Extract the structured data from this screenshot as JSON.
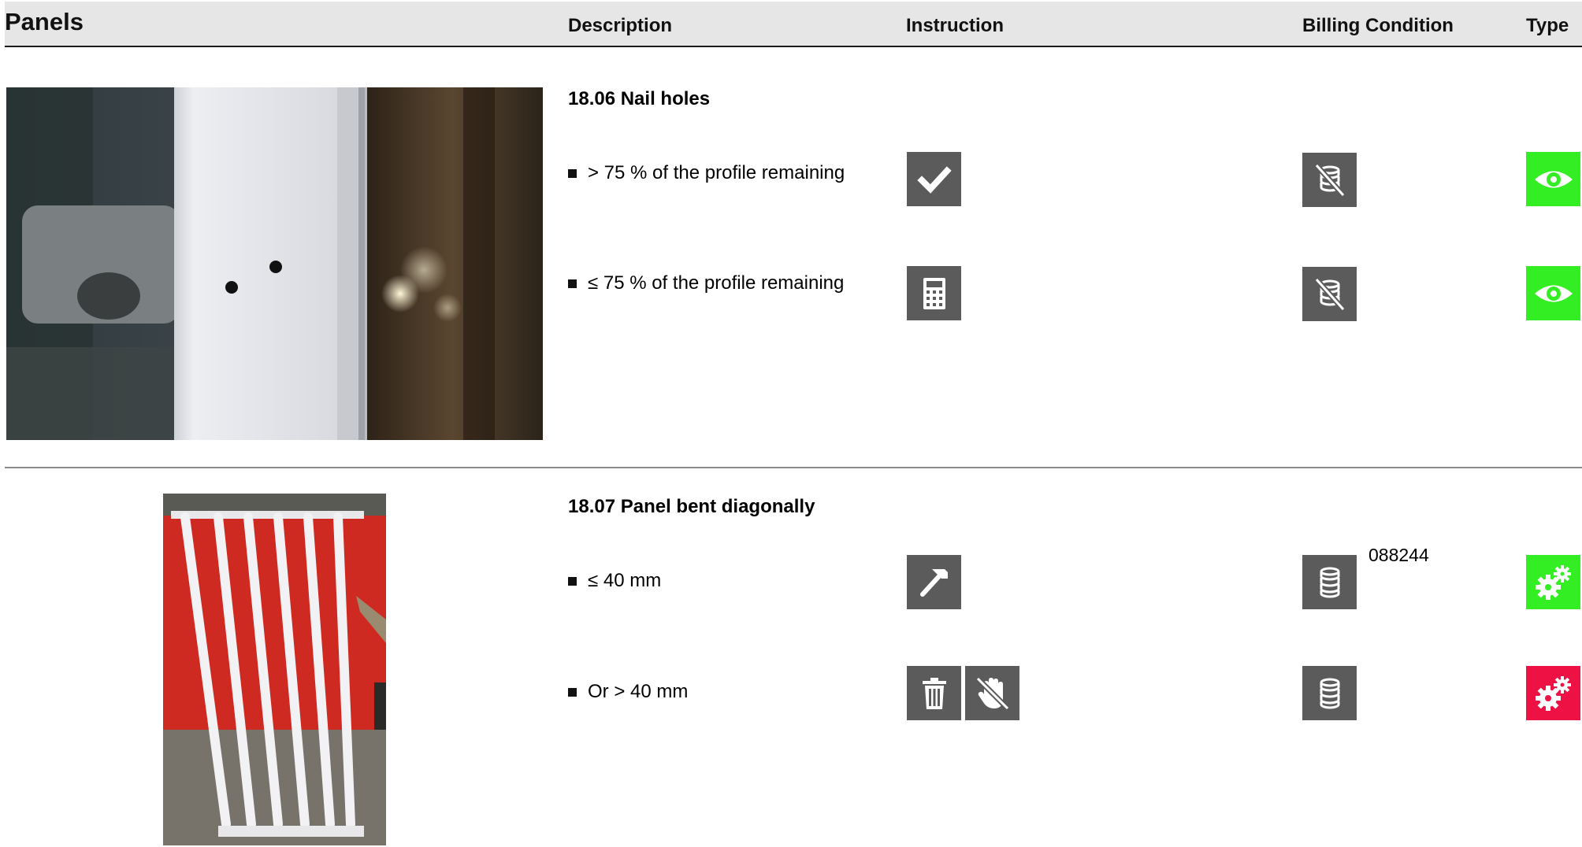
{
  "header": {
    "title": "Panels",
    "columns": {
      "description": "Description",
      "instruction": "Instruction",
      "billing": "Billing Condition",
      "type": "Type"
    }
  },
  "sections": [
    {
      "title": "18.06 Nail holes",
      "photo_icon": "nail-holes-photo",
      "rows": [
        {
          "text": "> 75 % of the profile remaining",
          "instruction_icons": [
            "check-icon"
          ],
          "billing_icon": "no-billing-coins-icon",
          "billing_code": "",
          "type_icon": "eye-icon",
          "type_color": "#33ee22"
        },
        {
          "text": "≤ 75 % of the profile remaining",
          "instruction_icons": [
            "calculator-icon"
          ],
          "billing_icon": "no-billing-coins-icon",
          "billing_code": "",
          "type_icon": "eye-icon",
          "type_color": "#33ee22"
        }
      ]
    },
    {
      "title": "18.07 Panel bent diagonally",
      "photo_icon": "bent-panel-photo",
      "rows": [
        {
          "text": "≤ 40 mm",
          "instruction_icons": [
            "hammer-icon"
          ],
          "billing_icon": "coins-icon",
          "billing_code": "088244",
          "type_icon": "gears-icon",
          "type_color": "#33ee22"
        },
        {
          "text": "Or > 40 mm",
          "instruction_icons": [
            "trash-icon",
            "no-hand-icon"
          ],
          "billing_icon": "coins-icon",
          "billing_code": "",
          "type_icon": "gears-icon",
          "type_color": "#ee1144"
        }
      ]
    }
  ],
  "colors": {
    "icon_bg": "#5b5b5b",
    "header_bg": "#e6e6e6",
    "green": "#33ee22",
    "red": "#ee1144"
  }
}
